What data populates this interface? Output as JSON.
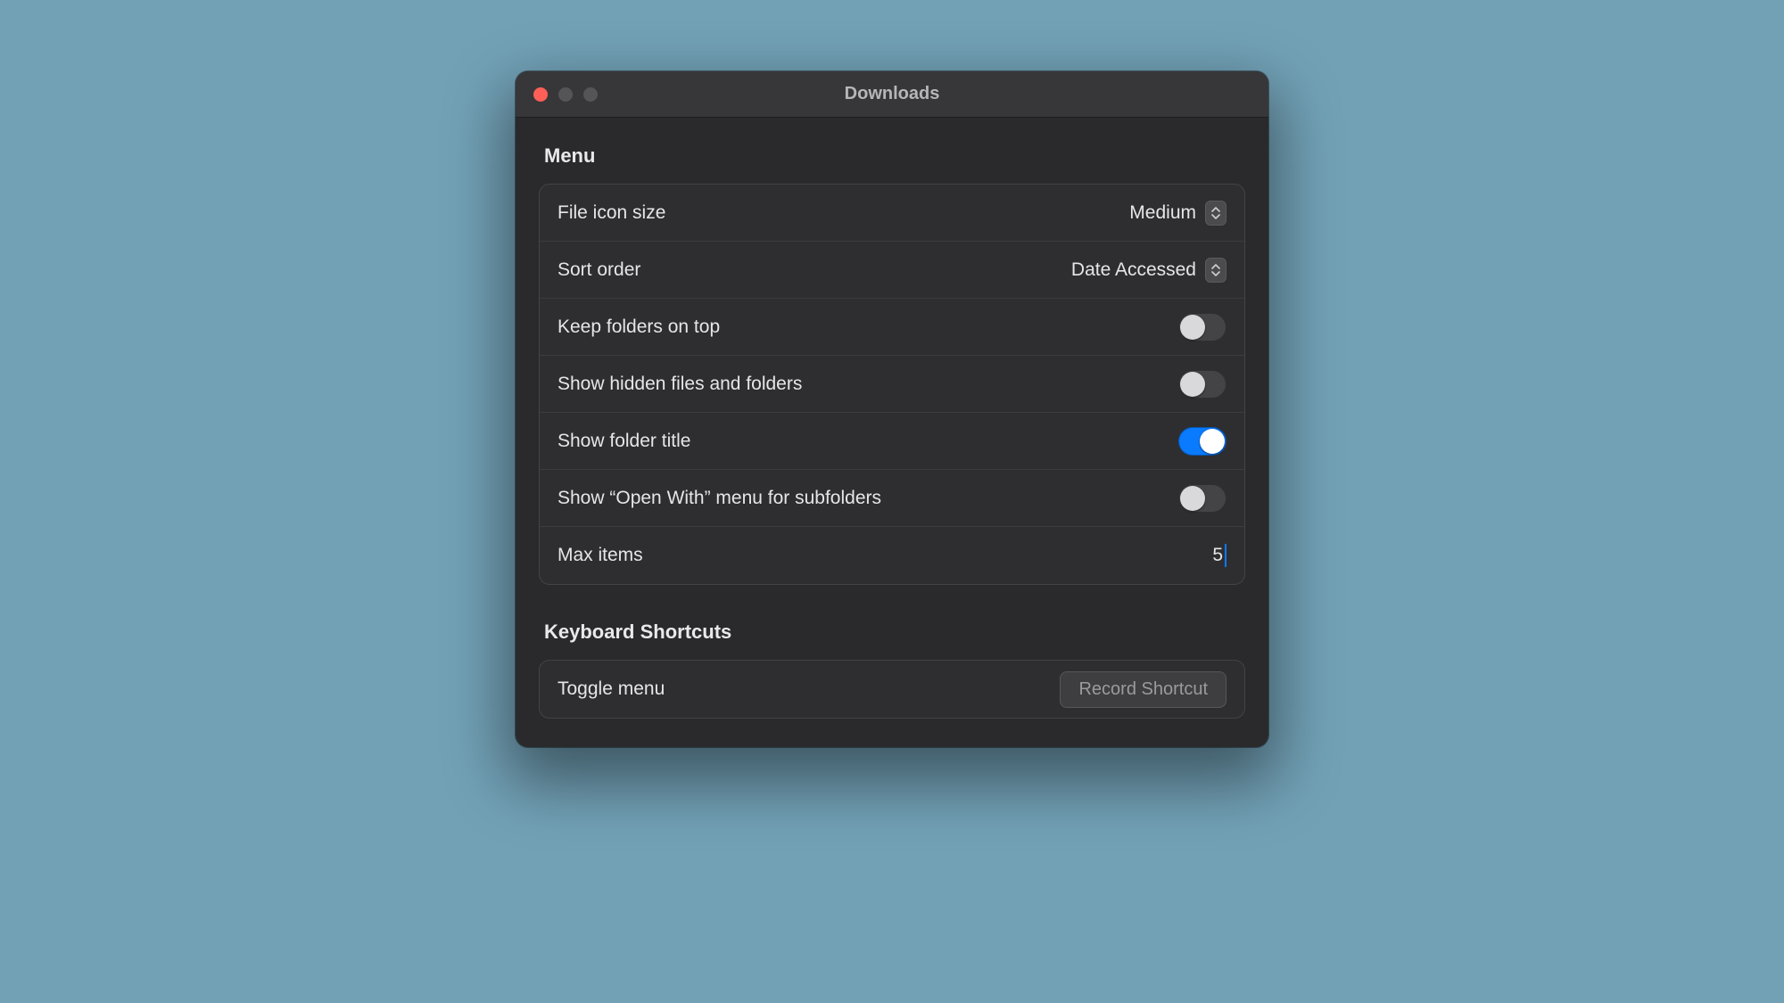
{
  "window": {
    "title": "Downloads"
  },
  "sections": {
    "menu": {
      "header": "Menu",
      "file_icon_size": {
        "label": "File icon size",
        "value": "Medium"
      },
      "sort_order": {
        "label": "Sort order",
        "value": "Date Accessed"
      },
      "keep_folders_top": {
        "label": "Keep folders on top",
        "on": false
      },
      "show_hidden": {
        "label": "Show hidden files and folders",
        "on": false
      },
      "show_folder_title": {
        "label": "Show folder title",
        "on": true
      },
      "show_open_with": {
        "label": "Show “Open With” menu for subfolders",
        "on": false
      },
      "max_items": {
        "label": "Max items",
        "value": "5"
      }
    },
    "shortcuts": {
      "header": "Keyboard Shortcuts",
      "toggle_menu": {
        "label": "Toggle menu",
        "button": "Record Shortcut"
      }
    }
  }
}
